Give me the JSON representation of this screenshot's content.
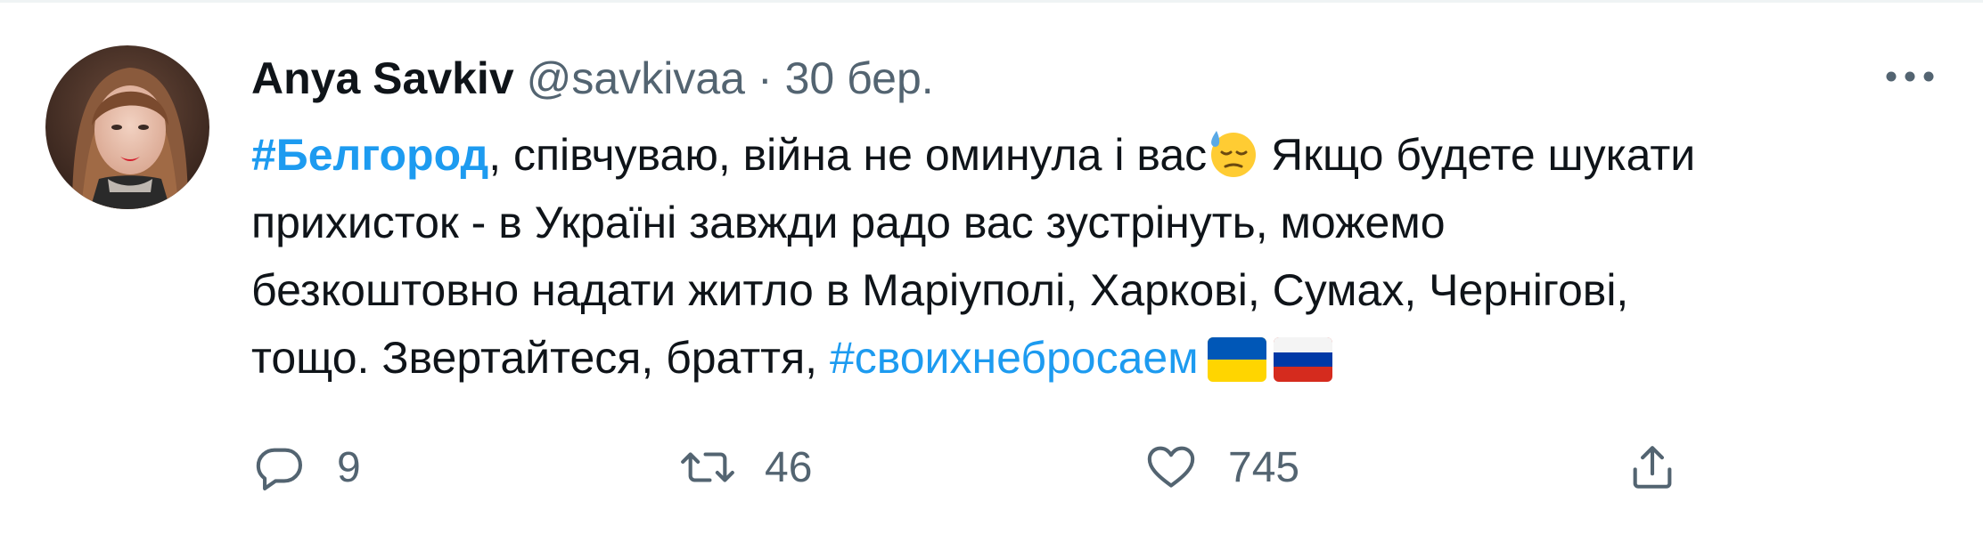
{
  "tweet": {
    "author": {
      "display_name": "Anya Savkiv",
      "handle": "@savkivaa"
    },
    "separator": "·",
    "date": "30 бер.",
    "text": {
      "line1_hashtag": "#Белгород",
      "line1_text": ", співчуваю, війна не оминула і вас",
      "line1_emoji": "downcast-face-with-sweat-emoji",
      "line1_text_after": " Якщо будете шукати",
      "line2": "прихисток - в Україні завжди радо вас зустрінуть, можемо",
      "line3": "безкоштовно надати житло в Маріуполі, Харкові, Сумах, Чернігові,",
      "line4_text": "тощо. Звертайтеся, браття, ",
      "line4_hashtag": "#своихнебросаем",
      "flags": [
        "ukraine-flag",
        "russia-flag"
      ]
    },
    "actions": {
      "reply_count": "9",
      "retweet_count": "46",
      "like_count": "745"
    },
    "icons": {
      "more": "more-icon",
      "reply": "reply-icon",
      "retweet": "retweet-icon",
      "like": "heart-icon",
      "share": "share-icon"
    },
    "colors": {
      "link": "#1d9bf0",
      "text": "#0f1419",
      "secondary": "#536471"
    }
  }
}
